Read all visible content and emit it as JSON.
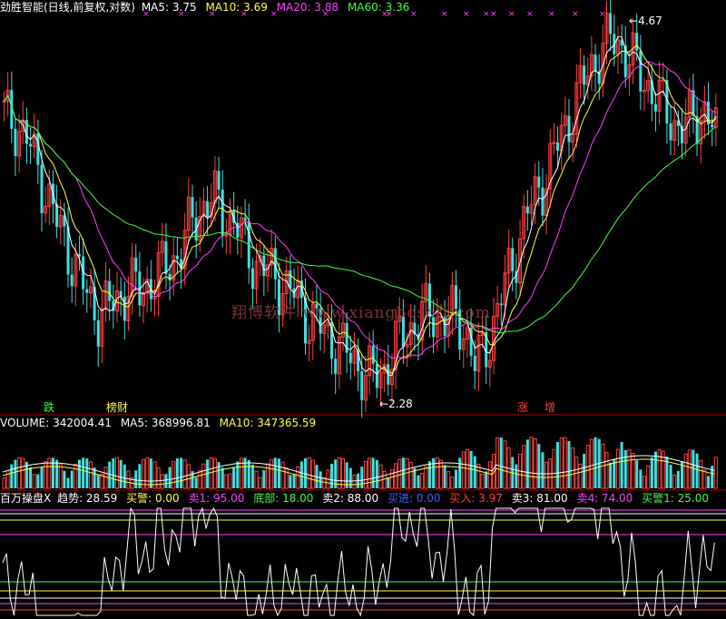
{
  "main_header": {
    "title": "劲胜智能(日线,前复权,对数)",
    "ma5": "MA5: 3.75",
    "ma10": "MA10: 3.69",
    "ma20": "MA20: 3.88",
    "ma60": "MA60: 3.36"
  },
  "price_annotations": {
    "high": "4.67",
    "low": "2.28"
  },
  "signal_labels": {
    "die": "跌",
    "bangcai": "榜财",
    "zhang": "涨",
    "zeng": "增"
  },
  "watermark": "翔博软件 www.xiangbosoft.com",
  "volume_header": {
    "volume": "VOLUME: 342004.41",
    "ma5": "MA5: 368996.81",
    "ma10": "MA10: 347365.59"
  },
  "indicator_header": {
    "name": "百万操盘X",
    "trend": "趋势: 28.59",
    "buy_alert": "买警: 0.00",
    "sell1": "卖1: 95.00",
    "bottom": "底部: 18.00",
    "sell2": "卖2: 88.00",
    "buy_in": "买进: 0.00",
    "buy": "买入: 3.97",
    "sell3": "卖3: 81.00",
    "sell4": "卖4: 74.00",
    "buy_alert1": "买警1: 25.00"
  },
  "colors": {
    "up": "#ff4040",
    "down": "#40e0e0",
    "ma5": "#ffffff",
    "ma10": "#ffff40",
    "ma20": "#ff40ff",
    "ma60": "#40ff40",
    "separator": "#a00000"
  },
  "chart_data": {
    "type": "candlestick",
    "title": "劲胜智能(日线,前复权,对数)",
    "price_high": 4.67,
    "price_low": 2.28,
    "volume": 342004.41,
    "indicators": {
      "MA5": 3.75,
      "MA10": 3.69,
      "MA20": 3.88,
      "MA60": 3.36,
      "VOL_MA5": 368996.81,
      "VOL_MA10": 347365.59,
      "趋势": 28.59,
      "买警": 0.0,
      "卖1": 95.0,
      "底部": 18.0,
      "卖2": 88.0,
      "买进": 0.0,
      "买入": 3.97,
      "卖3": 81.0,
      "卖4": 74.0,
      "买警1": 25.0
    },
    "close_path": [
      3.9,
      3.85,
      3.75,
      3.55,
      3.35,
      3.15,
      3.0,
      2.85,
      2.7,
      2.62,
      2.65,
      2.7,
      2.78,
      2.72,
      2.8,
      2.85,
      2.9,
      3.0,
      3.15,
      3.25,
      3.3,
      3.2,
      3.15,
      3.0,
      2.9,
      2.85,
      2.82,
      2.75,
      2.7,
      2.6,
      2.55,
      2.5,
      2.45,
      2.4,
      2.35,
      2.3,
      2.32,
      2.4,
      2.5,
      2.55,
      2.6,
      2.62,
      2.58,
      2.6,
      2.55,
      2.35,
      2.45,
      2.6,
      2.8,
      3.0,
      3.2,
      3.35,
      3.5,
      3.7,
      3.9,
      4.1,
      4.3,
      4.45,
      4.55,
      4.5,
      4.35,
      4.2,
      4.1,
      3.95,
      3.85,
      3.8,
      3.9,
      3.95,
      3.75
    ]
  }
}
